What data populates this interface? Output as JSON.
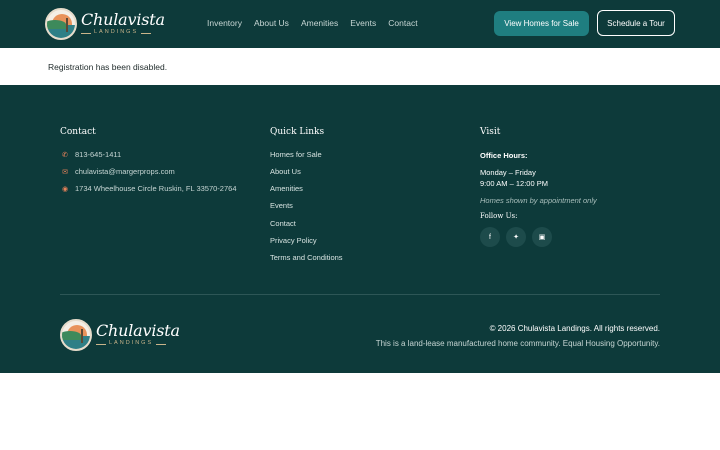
{
  "brand": {
    "name": "Chulavista",
    "tagline": "LANDINGS"
  },
  "nav": {
    "items": [
      "Inventory",
      "About Us",
      "Amenities",
      "Events",
      "Contact"
    ]
  },
  "header_buttons": {
    "primary": "View Homes for Sale",
    "secondary": "Schedule a Tour"
  },
  "notice": "Registration has been disabled.",
  "footer": {
    "contact": {
      "title": "Contact",
      "phone": "813-645-1411",
      "email": "chulavista@margerprops.com",
      "address": "1734 Wheelhouse Circle Ruskin, FL 33570-2764"
    },
    "quick_links": {
      "title": "Quick Links",
      "items": [
        "Homes for Sale",
        "About Us",
        "Amenities",
        "Events",
        "Contact",
        "Privacy Policy",
        "Terms and Conditions"
      ]
    },
    "visit": {
      "title": "Visit",
      "hours_label": "Office Hours:",
      "days": "Monday – Friday",
      "hours": "9:00 AM – 12:00 PM",
      "note": "Homes shown by appointment only",
      "follow_label": "Follow Us:",
      "social": [
        "facebook-icon",
        "twitter-icon",
        "instagram-icon"
      ]
    },
    "copyright": "© 2026 Chulavista Landings. All rights reserved.",
    "equal_housing": "This is a land-lease manufactured home community. Equal Housing Opportunity."
  },
  "colors": {
    "header_bg": "#0d3a3a",
    "accent_button": "#1f7e80",
    "icon_accent": "#e8825a"
  }
}
